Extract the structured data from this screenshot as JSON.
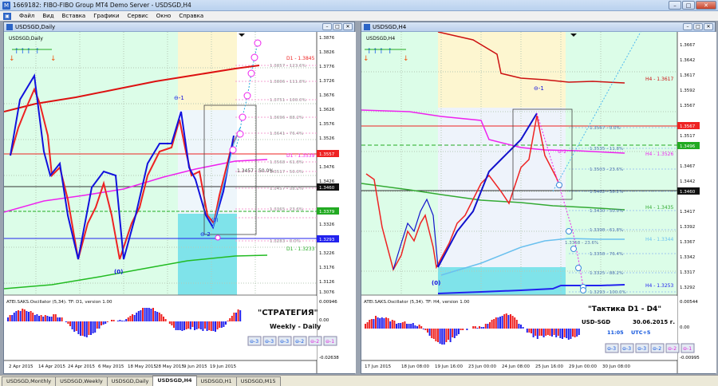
{
  "app": {
    "title": "1669182: FIBO-FIBO Group MT4 Demo Server - USDSGD,H4",
    "icon": "mt4-app-icon",
    "controls": [
      "–",
      "□",
      "✕"
    ]
  },
  "menu": [
    "Файл",
    "Вид",
    "Вставка",
    "Графики",
    "Сервис",
    "Окно",
    "Справка"
  ],
  "tabs": [
    "USDSGD,Monthly",
    "USDSGD,Weekly",
    "USDSGD,Daily",
    "USDSGD,H4",
    "USDSGD,H1",
    "USDSGD,M15"
  ],
  "active_tab": 3,
  "left": {
    "title": "USDSGD,Daily",
    "symbol": "USDSGD,Daily",
    "price_ticks": [
      "1.3876",
      "1.3826",
      "1.3776",
      "1.3726",
      "1.3676",
      "1.3626",
      "1.3576",
      "1.3526",
      "1.3476",
      "1.3426",
      "1.3376",
      "1.3326",
      "1.3276",
      "1.3226",
      "1.3176",
      "1.3126",
      "1.3076",
      "1.3026"
    ],
    "tag_high": "1.3557",
    "tag_cur": "1.3460",
    "tag_green": "1.3379",
    "tag_blue": "1.3293",
    "fib_levels": [
      "1.3857 - 123.6%",
      "1.3806 - 111.8%",
      "1.3751 - 100.0%",
      "1.3696 - 88.2%",
      "1.3641 - 76.4%",
      "1.3568 - 61.8%",
      "1.3517 - 50.0%",
      "1.3457 - 38.2%",
      "1.3365 - 23.6%",
      "1.3283 - 0.0%"
    ],
    "fib_mid": "1.3457 - 50.0%",
    "d1_labels": [
      "D1 - 1.3845",
      "D1 - 1.3539",
      "D1 - 1.3233"
    ],
    "wave_labels": {
      "w1": "⊖-1",
      "w2": "⊖-2",
      "w0": "(0)",
      "w0b": "(0)"
    },
    "osc_title": "ATEI.SAKS.Oscillator (5,34). TF: D1, version 1.00",
    "osc_ticks": [
      "0.00946",
      "0.00",
      "-0.02638"
    ],
    "strategy": "\"СТРАТЕГИЯ\"",
    "strategy_sub": "Weekly - Daily",
    "date_ticks": [
      "2 Apr 2015",
      "14 Apr 2015",
      "24 Apr 2015",
      "6 May 2015",
      "18 May 2015",
      "28 May 2015",
      "9 Jun 2015",
      "19 Jun 2015"
    ],
    "buttons": [
      "⊖-3",
      "⊖-3",
      "⊖-3",
      "⊖-2",
      "⊖-2",
      "⊖-1"
    ]
  },
  "right": {
    "title": "USDSGD,H4",
    "symbol": "USDSGD,H4",
    "price_ticks": [
      "1.3667",
      "1.3642",
      "1.3617",
      "1.3592",
      "1.3567",
      "1.3542",
      "1.3517",
      "1.3492",
      "1.3467",
      "1.3442",
      "1.3417",
      "1.3392",
      "1.3367",
      "1.3342",
      "1.3317",
      "1.3292",
      "1.3267",
      "1.3242"
    ],
    "tag_top": "1.3567",
    "tag_g": "1.3496",
    "tag_cur": "1.3460",
    "fib_levels": [
      "1.3567 - 0.0%",
      "1.3535 - 11.8%",
      "1.3503 - 23.6%",
      "1.3462 - 38.2%",
      "1.3430 - 50.0%",
      "1.3398 - 61.8%",
      "1.3358 - 23.6%",
      "1.3358 - 76.4%",
      "1.3325 - 88.2%",
      "1.3293 - 100.0%",
      "1.3261 - 111.8%"
    ],
    "h4_labels": [
      "H4 - 1.3617",
      "H4 - 1.3526",
      "H4 - 1.3435",
      "H4 - 1.3344",
      "H4 - 1.3253"
    ],
    "osc_title": "ATEI.SAKS.Oscillator (5,34). TF: H4, version 1.00",
    "osc_ticks": [
      "0.00544",
      "0.00",
      "-0.00995"
    ],
    "tactic": "\"Тактика  D1 - D4\"",
    "pair": "USD-SGD",
    "date": "30.06.2015 г.",
    "time": "11:05",
    "utc": "UTC+5",
    "date_ticks": [
      "17 Jun 2015",
      "18 Jun 08:00",
      "19 Jun 16:00",
      "23 Jun 00:00",
      "24 Jun 08:00",
      "25 Jun 16:00",
      "29 Jun 00:00",
      "30 Jun 08:00"
    ],
    "buttons": [
      "⊖-3",
      "⊖-3",
      "⊖-3",
      "⊖-2",
      "⊖-2",
      "⊖-1"
    ],
    "wave_labels": {
      "w1": "⊖-1",
      "w0": "(0)",
      "w2": "⊖-2"
    }
  },
  "colors": {
    "bull": "#0000ee",
    "bear": "#ee0000",
    "magenta": "#ff33ff",
    "green": "#22aa22",
    "cyan": "#4fd0e0"
  }
}
